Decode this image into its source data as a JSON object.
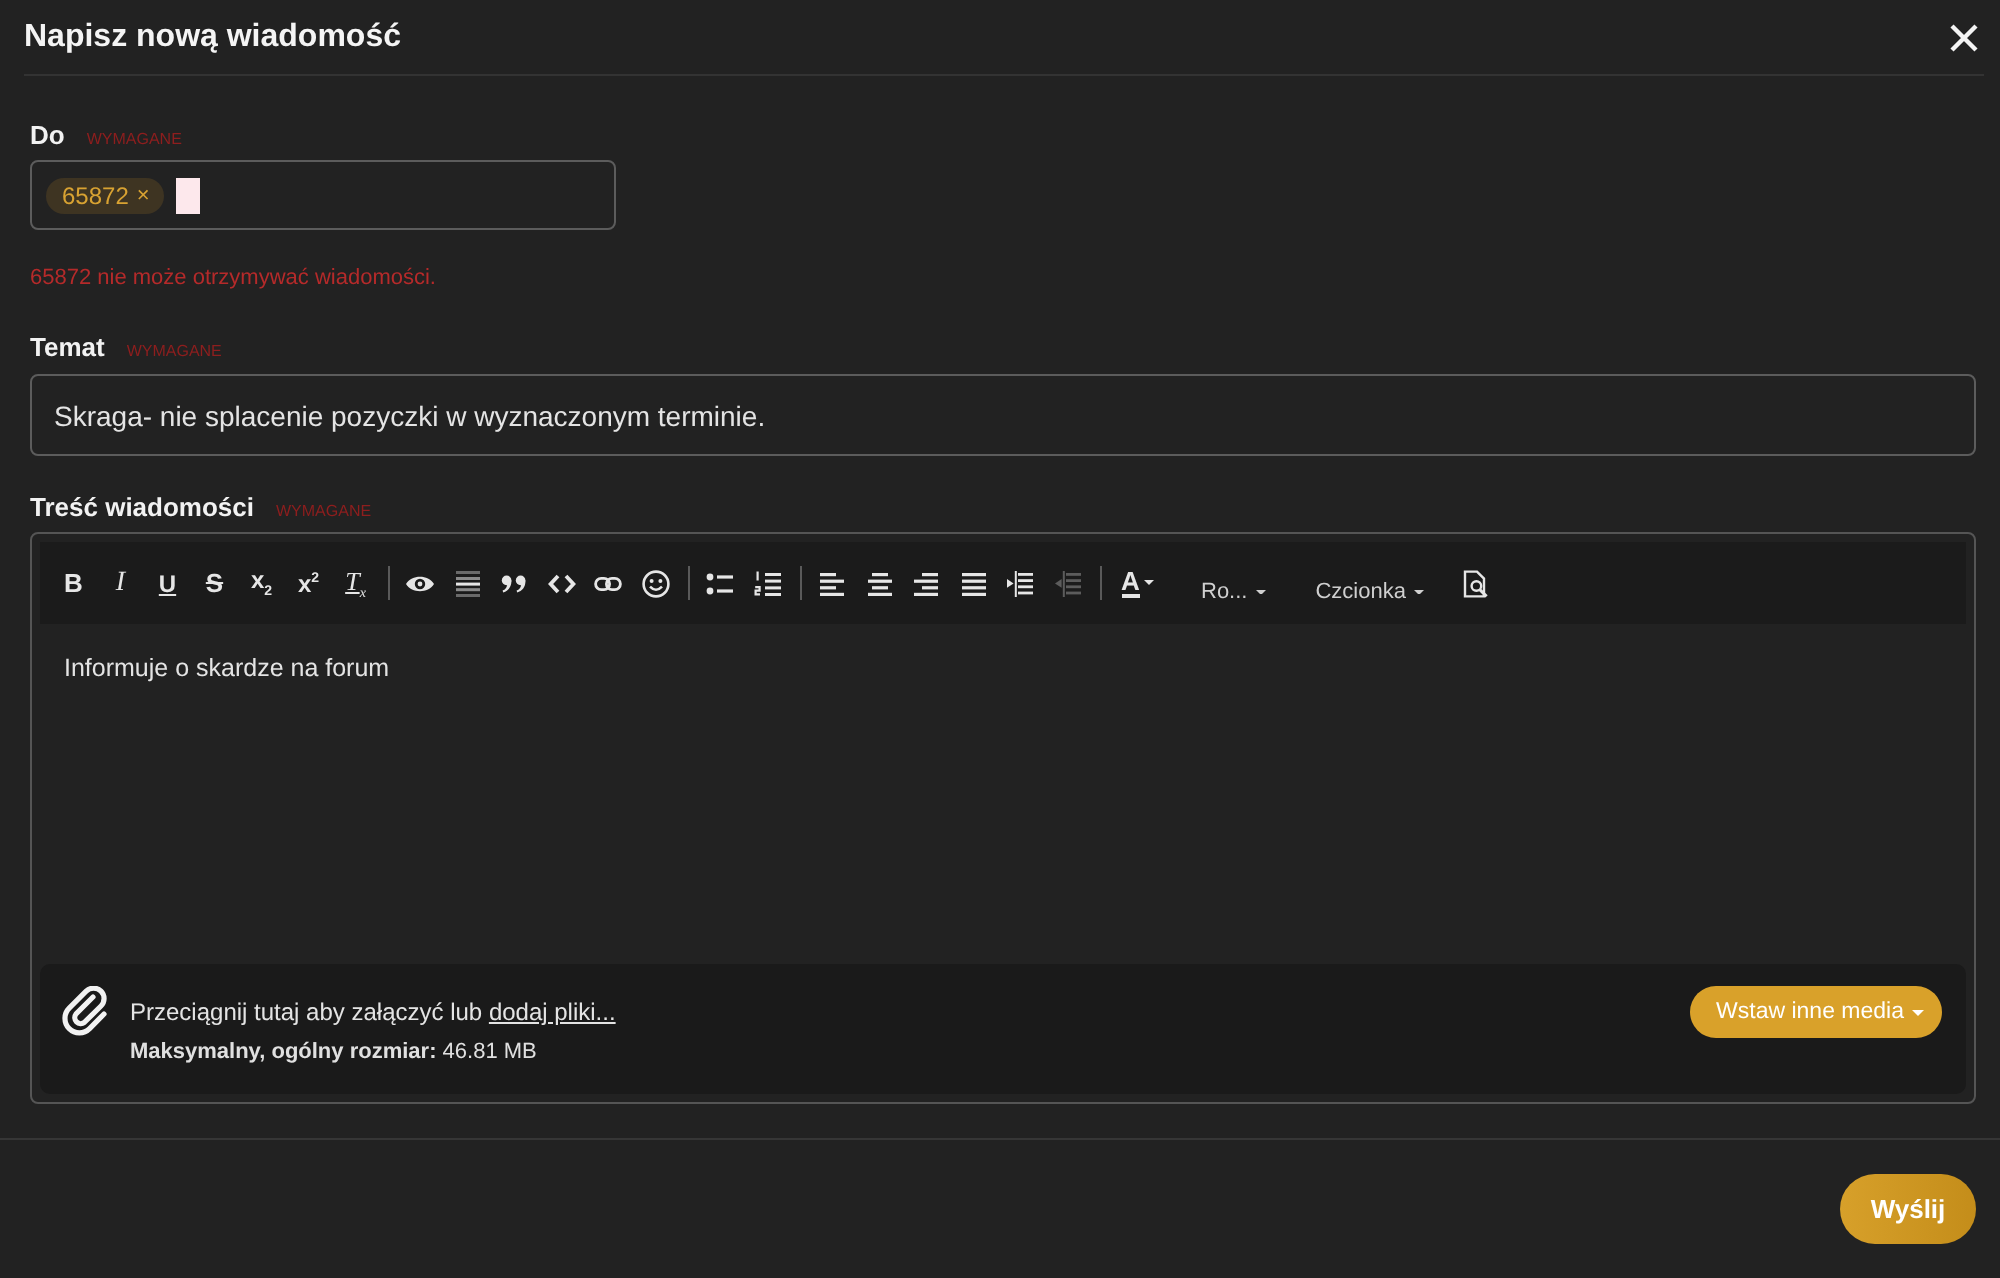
{
  "dialog": {
    "title": "Napisz nową wiadomość"
  },
  "recipient": {
    "label": "Do",
    "required_note": "WYMAGANE",
    "tokens": [
      {
        "text": "65872",
        "remove": "×"
      }
    ],
    "error": "65872 nie może otrzymywać wiadomości."
  },
  "subject": {
    "label": "Temat",
    "required_note": "WYMAGANE",
    "value": "Skraga- nie splacenie pozyczki w wyznaczonym terminie."
  },
  "message": {
    "label": "Treść wiadomości",
    "required_note": "WYMAGANE",
    "toolbar": [
      {
        "items": [
          {
            "kind": "bold",
            "label": "B",
            "disabled": false
          },
          {
            "kind": "italic",
            "label": "I",
            "disabled": false
          },
          {
            "kind": "underline",
            "label": "U",
            "disabled": false
          },
          {
            "kind": "strike",
            "label": "S",
            "disabled": false
          },
          {
            "kind": "subscript",
            "label": "x$_{2}$",
            "disabled": false
          },
          {
            "kind": "superscript",
            "label": "x$^{2}$",
            "disabled": false
          },
          {
            "kind": "clear-format",
            "label": "T$_{x}$",
            "disabled": false
          }
        ]
      },
      {
        "items": [
          {
            "kind": "eye",
            "disabled": false
          },
          {
            "kind": "horizontal-rule",
            "disabled": false
          },
          {
            "kind": "quote",
            "disabled": false
          },
          {
            "kind": "code",
            "disabled": false
          },
          {
            "kind": "link",
            "disabled": false
          },
          {
            "kind": "emoji",
            "disabled": false
          }
        ]
      },
      {
        "items": [
          {
            "kind": "bullet-list",
            "disabled": false
          },
          {
            "kind": "numbered-list",
            "disabled": false
          }
        ]
      },
      {
        "items": [
          {
            "kind": "align-left",
            "disabled": false
          },
          {
            "kind": "align-center",
            "disabled": false
          },
          {
            "kind": "align-right",
            "disabled": false
          },
          {
            "kind": "justify",
            "disabled": false
          },
          {
            "kind": "indent",
            "disabled": false
          },
          {
            "kind": "outdent",
            "disabled": true
          }
        ]
      },
      {
        "items": [
          {
            "kind": "text-color",
            "label": "A",
            "disabled": false
          },
          {
            "kind": "dropdown",
            "label": "Ro...",
            "disabled": false
          },
          {
            "kind": "dropdown",
            "label": "Czcionka",
            "disabled": false
          },
          {
            "kind": "preview",
            "disabled": false
          }
        ]
      }
    ],
    "body": "Informuje o skardze na forum",
    "attachments": {
      "hint": "Przeciągnij tutaj aby załączyć lub",
      "link": "dodaj pliki...",
      "limit": "**Maksymalny, ogólny rozmiar:** 46.81 MB",
      "media_button": "Wstaw inne media"
    }
  },
  "footer": {
    "send_button": "Wyślij"
  }
}
